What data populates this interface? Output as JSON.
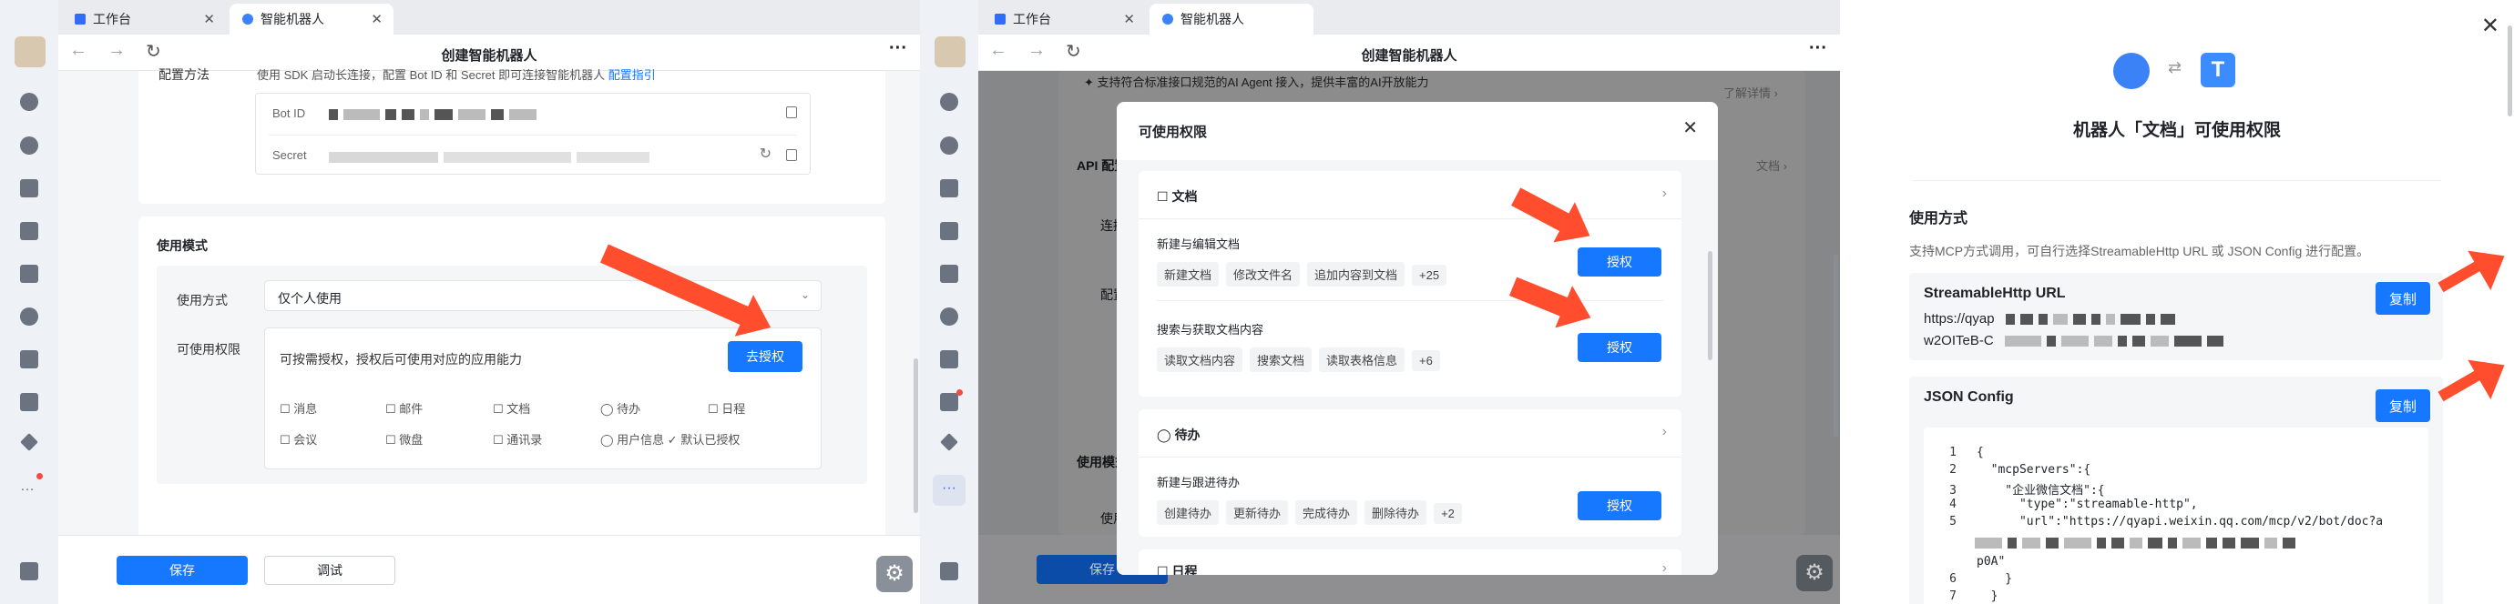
{
  "p1": {
    "tabs": [
      {
        "label": "工作台"
      },
      {
        "label": "智能机器人"
      }
    ],
    "title": "创建智能机器人",
    "config_label": "配置方法",
    "config_desc": "使用 SDK 启动长连接，配置 Bot ID 和 Secret 即可连接智能机器人",
    "config_link": "配置指引",
    "bot_id_label": "Bot ID",
    "secret_label": "Secret",
    "mode_section": "使用模式",
    "mode_label": "使用方式",
    "mode_value": "仅个人使用",
    "perm_label": "可使用权限",
    "perm_desc": "可按需授权，授权后可使用对应的应用能力",
    "auth_btn": "去授权",
    "perms": [
      "消息",
      "邮件",
      "文档",
      "待办",
      "日程",
      "会议",
      "微盘",
      "通讯录",
      "用户信息"
    ],
    "default_auth": "默认已授权",
    "save_btn": "保存",
    "debug_btn": "调试"
  },
  "p2": {
    "tabs": [
      {
        "label": "工作台"
      },
      {
        "label": "智能机器人"
      }
    ],
    "title": "创建智能机器人",
    "bg_desc": "支持符合标准接口规范的AI Agent 接入，提供丰富的AI开放能力",
    "bg_more": "了解详情 ›",
    "bg_api": "API 配置",
    "bg_conn": "连接",
    "bg_cfg": "配置",
    "bg_mode": "使用模式",
    "bg_use": "使用",
    "bg_doc": "文档 ›",
    "modal_title": "可使用权限",
    "sections": [
      {
        "name": "文档",
        "groups": [
          {
            "title": "新建与编辑文档",
            "chips": [
              "新建文档",
              "修改文件名",
              "追加内容到文档",
              "+25"
            ],
            "btn": "授权"
          },
          {
            "title": "搜索与获取文档内容",
            "chips": [
              "读取文档内容",
              "搜索文档",
              "读取表格信息",
              "+6"
            ],
            "btn": "授权"
          }
        ]
      },
      {
        "name": "待办",
        "groups": [
          {
            "title": "新建与跟进待办",
            "chips": [
              "创建待办",
              "更新待办",
              "完成待办",
              "删除待办",
              "+2"
            ],
            "btn": "授权"
          }
        ]
      },
      {
        "name": "日程",
        "groups": []
      }
    ],
    "save_btn": "保存"
  },
  "p3": {
    "title": "机器人「文档」可使用权限",
    "usage_title": "使用方式",
    "usage_desc": "支持MCP方式调用，可自行选择StreamableHttp URL 或 JSON Config 进行配置。",
    "stream_title": "StreamableHttp URL",
    "url_line1": "https://qyap",
    "url_line2": "w2OITeB-C",
    "copy_btn": "复制",
    "json_title": "JSON Config",
    "code_lines": [
      {
        "n": "1",
        "t": "{"
      },
      {
        "n": "2",
        "t": "  \"mcpServers\":{"
      },
      {
        "n": "3",
        "t": "    \"企业微信文档\":{"
      },
      {
        "n": "4",
        "t": "      \"type\":\"streamable-http\","
      },
      {
        "n": "5",
        "t": "      \"url\":\"https://qyapi.weixin.qq.com/mcp/v2/bot/doc?a"
      },
      {
        "n": "",
        "t": "p0A\""
      },
      {
        "n": "6",
        "t": "    }"
      },
      {
        "n": "7",
        "t": "  }"
      }
    ]
  }
}
